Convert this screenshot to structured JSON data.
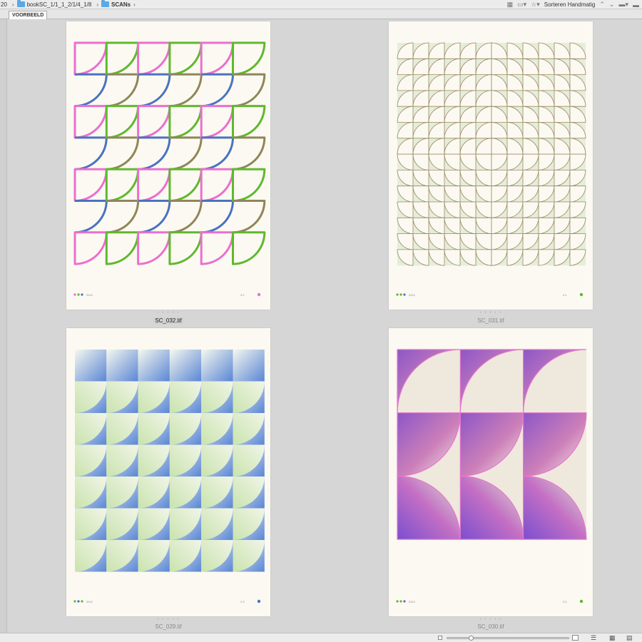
{
  "path": {
    "lead": "20",
    "crumbs": [
      "bookSC_1/1_1_2/1/4_1/8",
      "SCANs"
    ]
  },
  "toolbar": {
    "sort_label": "Sorteren Handmatig"
  },
  "tab": {
    "label": "VOORBEELD"
  },
  "thumbnails": [
    {
      "filename": "SC_032.tif",
      "selected": true,
      "dots": "· · · · ·",
      "footer_left": "2012",
      "footer_right": "3.2"
    },
    {
      "filename": "SC_031.tif",
      "selected": false,
      "dots": "· · · · ·",
      "footer_left": "2012",
      "footer_right": "3.1"
    },
    {
      "filename": "SC_029.tif",
      "selected": false,
      "dots": "· · · · ·",
      "footer_left": "2012",
      "footer_right": "2.9"
    },
    {
      "filename": "SC_030.tif",
      "selected": false,
      "dots": "· · · · ·",
      "footer_left": "2012",
      "footer_right": "3.0"
    }
  ],
  "colors": {
    "pink": "#ea6fcf",
    "blue": "#4a72c0",
    "green": "#5fb82e",
    "olive": "#8f8659",
    "paper": "#fbf9f1",
    "purple": "#8d56c8",
    "lightgreen": "#d9ebc6"
  },
  "zoom_slider": {
    "value": 0.18
  }
}
